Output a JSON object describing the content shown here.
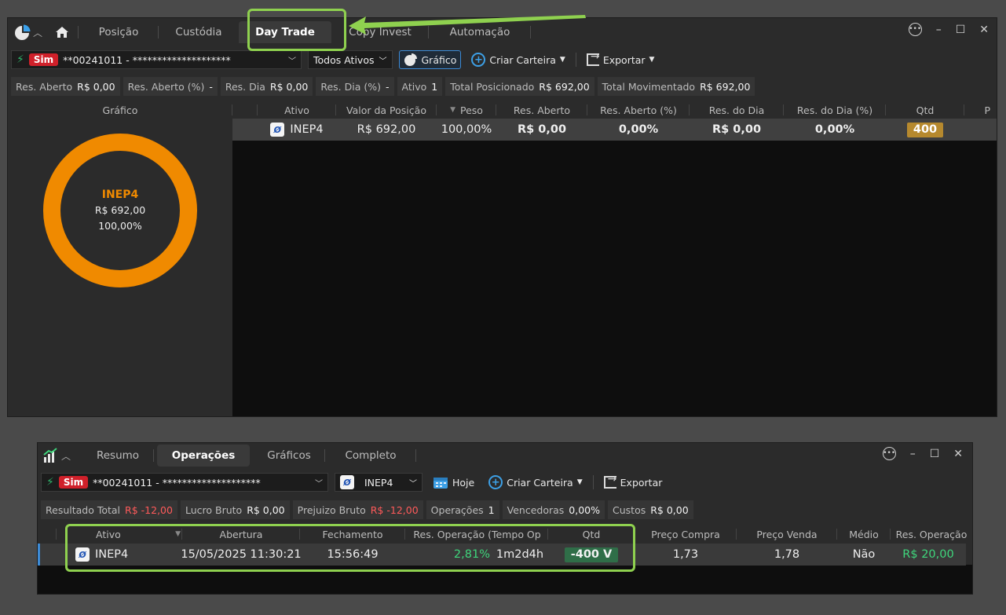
{
  "window1": {
    "tabs": [
      "Posição",
      "Custódia",
      "Day Trade",
      "Copy Invest",
      "Automação"
    ],
    "active_tab": "Day Trade",
    "account": {
      "badge": "Sim",
      "label": "**00241011 - ********************"
    },
    "filter": "Todos Ativos",
    "toolbar": {
      "chart_label": "Gráfico",
      "create_label": "Criar Carteira",
      "export_label": "Exportar"
    },
    "stats": [
      {
        "label": "Res. Aberto",
        "value": "R$ 0,00"
      },
      {
        "label": "Res. Aberto (%)",
        "value": "-"
      },
      {
        "label": "Res. Dia",
        "value": "R$ 0,00"
      },
      {
        "label": "Res. Dia (%)",
        "value": "-"
      },
      {
        "label": "Ativo",
        "value": "1"
      },
      {
        "label": "Total Posicionado",
        "value": "R$ 692,00"
      },
      {
        "label": "Total Movimentado",
        "value": "R$ 692,00"
      }
    ],
    "chart_header": "Gráfico",
    "columns": [
      "Ativo",
      "Valor da Posição",
      "Peso",
      "Res. Aberto",
      "Res. Aberto (%)",
      "Res. do Dia",
      "Res. do Dia (%)",
      "Qtd",
      "P"
    ],
    "row": {
      "ativo": "INEP4",
      "valor": "R$ 692,00",
      "peso": "100,00%",
      "res_aberto": "R$ 0,00",
      "res_aberto_pct": "0,00%",
      "res_dia": "R$ 0,00",
      "res_dia_pct": "0,00%",
      "qtd": "400"
    },
    "donut": {
      "name": "INEP4",
      "value": "R$ 692,00",
      "pct": "100,00%",
      "color": "#f08a00",
      "share": 1.0
    }
  },
  "window2": {
    "tabs": [
      "Resumo",
      "Operações",
      "Gráficos",
      "Completo"
    ],
    "active_tab": "Operações",
    "account": {
      "badge": "Sim",
      "label": "**00241011 - ********************"
    },
    "asset_filter": "INEP4",
    "toolbar": {
      "today_label": "Hoje",
      "create_label": "Criar Carteira",
      "export_label": "Exportar"
    },
    "stats": [
      {
        "label": "Resultado Total",
        "value": "R$ -12,00",
        "red": true
      },
      {
        "label": "Lucro Bruto",
        "value": "R$ 0,00",
        "red": false
      },
      {
        "label": "Prejuizo Bruto",
        "value": "R$ -12,00",
        "red": true
      },
      {
        "label": "Operações",
        "value": "1",
        "red": false
      },
      {
        "label": "Vencedoras",
        "value": "0,00%",
        "red": false
      },
      {
        "label": "Custos",
        "value": "R$ 0,00",
        "red": false
      }
    ],
    "columns": [
      "Ativo",
      "Abertura",
      "Fechamento",
      "Res. Operação (",
      "Tempo Op",
      "Qtd",
      "Preço Compra",
      "Preço Venda",
      "Médio",
      "Res. Operação"
    ],
    "row": {
      "ativo": "INEP4",
      "abertura": "15/05/2025 11:30:21",
      "fechamento": "15:56:49",
      "res_pct": "2,81%",
      "tempo": "1m2d4h",
      "qtd": "-400 V",
      "preco_compra": "1,73",
      "preco_venda": "1,78",
      "medio": "Não",
      "res_operacao": "R$ 20,00"
    }
  },
  "colors": {
    "highlight": "#8fd14f",
    "accent_orange": "#f08a00",
    "sim_red": "#d0202a",
    "positive": "#3fd67c"
  }
}
